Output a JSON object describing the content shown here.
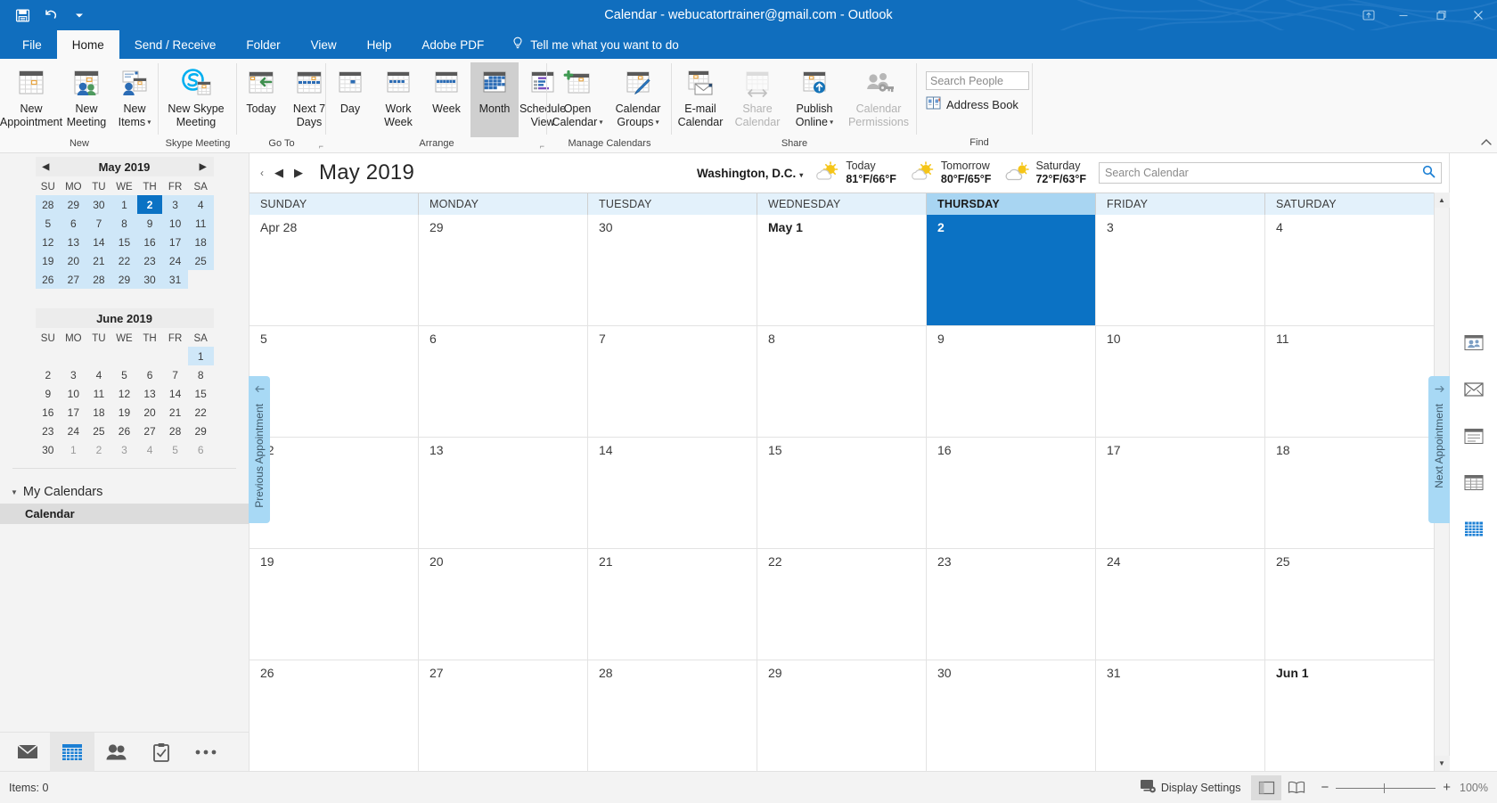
{
  "titlebar": {
    "title": "Calendar - webucatortrainer@gmail.com  -  Outlook",
    "qat": [
      {
        "name": "save-icon",
        "label": "Save"
      },
      {
        "name": "undo-icon",
        "label": "Undo"
      },
      {
        "name": "customize-qat-icon",
        "label": "Customize Quick Access Toolbar"
      }
    ],
    "window_buttons": [
      {
        "name": "ribbon-display-options-icon",
        "label": "Ribbon Display Options"
      },
      {
        "name": "minimize-icon",
        "label": "Minimize"
      },
      {
        "name": "restore-icon",
        "label": "Restore Down"
      },
      {
        "name": "close-icon",
        "label": "Close"
      }
    ]
  },
  "tabs": [
    {
      "id": "file",
      "label": "File",
      "active": false
    },
    {
      "id": "home",
      "label": "Home",
      "active": true
    },
    {
      "id": "send-receive",
      "label": "Send / Receive",
      "active": false
    },
    {
      "id": "folder",
      "label": "Folder",
      "active": false
    },
    {
      "id": "view",
      "label": "View",
      "active": false
    },
    {
      "id": "help",
      "label": "Help",
      "active": false
    },
    {
      "id": "adobe-pdf",
      "label": "Adobe PDF",
      "active": false
    }
  ],
  "tellme": "Tell me what you want to do",
  "ribbon": {
    "groups": [
      {
        "id": "new",
        "label": "New",
        "buttons": [
          {
            "id": "new-appointment",
            "label": "New\nAppointment",
            "icon": "calendar-new-icon"
          },
          {
            "id": "new-meeting",
            "label": "New\nMeeting",
            "icon": "calendar-people-icon"
          },
          {
            "id": "new-items",
            "label": "New\nItems",
            "icon": "new-items-icon",
            "dropdown": true
          }
        ]
      },
      {
        "id": "skype-meeting",
        "label": "Skype Meeting",
        "buttons": [
          {
            "id": "new-skype-meeting",
            "label": "New Skype\nMeeting",
            "icon": "skype-icon"
          }
        ]
      },
      {
        "id": "go-to",
        "label": "Go To",
        "dialog_launcher": true,
        "buttons": [
          {
            "id": "today",
            "label": "Today",
            "icon": "today-icon"
          },
          {
            "id": "next-7-days",
            "label": "Next 7\nDays",
            "icon": "next-7-days-icon"
          }
        ]
      },
      {
        "id": "arrange",
        "label": "Arrange",
        "dialog_launcher": true,
        "buttons": [
          {
            "id": "day",
            "label": "Day",
            "icon": "day-view-icon"
          },
          {
            "id": "work-week",
            "label": "Work\nWeek",
            "icon": "work-week-icon"
          },
          {
            "id": "week",
            "label": "Week",
            "icon": "week-view-icon"
          },
          {
            "id": "month",
            "label": "Month",
            "icon": "month-view-icon",
            "selected": true
          },
          {
            "id": "schedule-view",
            "label": "Schedule\nView",
            "icon": "schedule-view-icon"
          }
        ]
      },
      {
        "id": "manage-calendars",
        "label": "Manage Calendars",
        "buttons": [
          {
            "id": "open-calendar",
            "label": "Open\nCalendar",
            "icon": "open-calendar-icon",
            "dropdown": true
          },
          {
            "id": "calendar-groups",
            "label": "Calendar\nGroups",
            "icon": "calendar-groups-icon",
            "dropdown": true
          }
        ]
      },
      {
        "id": "share",
        "label": "Share",
        "buttons": [
          {
            "id": "email-calendar",
            "label": "E-mail\nCalendar",
            "icon": "email-calendar-icon"
          },
          {
            "id": "share-calendar",
            "label": "Share\nCalendar",
            "icon": "share-calendar-icon",
            "disabled": true
          },
          {
            "id": "publish-online",
            "label": "Publish\nOnline",
            "icon": "publish-online-icon",
            "dropdown": true
          },
          {
            "id": "calendar-permissions",
            "label": "Calendar\nPermissions",
            "icon": "calendar-permissions-icon",
            "disabled": true
          }
        ]
      },
      {
        "id": "find",
        "label": "Find",
        "search_people_placeholder": "Search People",
        "address_book_label": "Address Book"
      }
    ],
    "collapse_label": "Collapse the Ribbon"
  },
  "datenav": {
    "months": [
      {
        "id": "may-2019",
        "title": "May 2019",
        "show_arrows": true,
        "prev_label": "Previous month",
        "next_label": "Next month",
        "dow": [
          "SU",
          "MO",
          "TU",
          "WE",
          "TH",
          "FR",
          "SA"
        ],
        "weeks": [
          [
            {
              "d": "28",
              "hl": true
            },
            {
              "d": "29",
              "hl": true
            },
            {
              "d": "30",
              "hl": true
            },
            {
              "d": "1",
              "hl": true
            },
            {
              "d": "2",
              "today": true
            },
            {
              "d": "3",
              "hl": true
            },
            {
              "d": "4",
              "hl": true
            }
          ],
          [
            {
              "d": "5",
              "hl": true
            },
            {
              "d": "6",
              "hl": true
            },
            {
              "d": "7",
              "hl": true
            },
            {
              "d": "8",
              "hl": true
            },
            {
              "d": "9",
              "hl": true
            },
            {
              "d": "10",
              "hl": true
            },
            {
              "d": "11",
              "hl": true
            }
          ],
          [
            {
              "d": "12",
              "hl": true
            },
            {
              "d": "13",
              "hl": true
            },
            {
              "d": "14",
              "hl": true
            },
            {
              "d": "15",
              "hl": true
            },
            {
              "d": "16",
              "hl": true
            },
            {
              "d": "17",
              "hl": true
            },
            {
              "d": "18",
              "hl": true
            }
          ],
          [
            {
              "d": "19",
              "hl": true
            },
            {
              "d": "20",
              "hl": true
            },
            {
              "d": "21",
              "hl": true
            },
            {
              "d": "22",
              "hl": true
            },
            {
              "d": "23",
              "hl": true
            },
            {
              "d": "24",
              "hl": true
            },
            {
              "d": "25",
              "hl": true
            }
          ],
          [
            {
              "d": "26",
              "hl": true
            },
            {
              "d": "27",
              "hl": true
            },
            {
              "d": "28",
              "hl": true
            },
            {
              "d": "29",
              "hl": true
            },
            {
              "d": "30",
              "hl": true
            },
            {
              "d": "31",
              "hl": true
            },
            {
              "d": "",
              "hl": false
            }
          ]
        ]
      },
      {
        "id": "june-2019",
        "title": "June 2019",
        "show_arrows": false,
        "dow": [
          "SU",
          "MO",
          "TU",
          "WE",
          "TH",
          "FR",
          "SA"
        ],
        "weeks": [
          [
            {
              "d": ""
            },
            {
              "d": ""
            },
            {
              "d": ""
            },
            {
              "d": ""
            },
            {
              "d": ""
            },
            {
              "d": ""
            },
            {
              "d": "1",
              "hl": true
            }
          ],
          [
            {
              "d": "2"
            },
            {
              "d": "3"
            },
            {
              "d": "4"
            },
            {
              "d": "5"
            },
            {
              "d": "6"
            },
            {
              "d": "7"
            },
            {
              "d": "8"
            }
          ],
          [
            {
              "d": "9"
            },
            {
              "d": "10"
            },
            {
              "d": "11"
            },
            {
              "d": "12"
            },
            {
              "d": "13"
            },
            {
              "d": "14"
            },
            {
              "d": "15"
            }
          ],
          [
            {
              "d": "16"
            },
            {
              "d": "17"
            },
            {
              "d": "18"
            },
            {
              "d": "19"
            },
            {
              "d": "20"
            },
            {
              "d": "21"
            },
            {
              "d": "22"
            }
          ],
          [
            {
              "d": "23"
            },
            {
              "d": "24"
            },
            {
              "d": "25"
            },
            {
              "d": "26"
            },
            {
              "d": "27"
            },
            {
              "d": "28"
            },
            {
              "d": "29"
            }
          ],
          [
            {
              "d": "30"
            },
            {
              "d": "1",
              "dim": true
            },
            {
              "d": "2",
              "dim": true
            },
            {
              "d": "3",
              "dim": true
            },
            {
              "d": "4",
              "dim": true
            },
            {
              "d": "5",
              "dim": true
            },
            {
              "d": "6",
              "dim": true
            }
          ]
        ]
      }
    ]
  },
  "folderpane": {
    "group_label": "My Calendars",
    "items": [
      {
        "id": "calendar",
        "label": "Calendar",
        "selected": true
      }
    ]
  },
  "navbar": {
    "items": [
      {
        "id": "mail",
        "icon": "mail-icon",
        "label": "Mail",
        "active": false
      },
      {
        "id": "calendar",
        "icon": "calendar-icon",
        "label": "Calendar",
        "active": true
      },
      {
        "id": "people",
        "icon": "people-icon",
        "label": "People",
        "active": false
      },
      {
        "id": "tasks",
        "icon": "tasks-icon",
        "label": "Tasks",
        "active": false
      },
      {
        "id": "more",
        "icon": "more-options-icon",
        "label": "More",
        "active": false
      }
    ]
  },
  "calendar": {
    "collapse_pane_label": "Minimize the Folder Pane",
    "prev_label": "Back",
    "next_label": "Forward",
    "month_title": "May 2019",
    "location": "Washington,  D.C.",
    "weather": [
      {
        "id": "today",
        "icon": "partly-sunny-icon",
        "day": "Today",
        "temps": "81°F/66°F"
      },
      {
        "id": "tomorrow",
        "icon": "partly-sunny-icon",
        "day": "Tomorrow",
        "temps": "80°F/65°F"
      },
      {
        "id": "saturday",
        "icon": "partly-cloudy-icon",
        "day": "Saturday",
        "temps": "72°F/63°F"
      }
    ],
    "search_placeholder": "Search Calendar",
    "dow_headers": [
      {
        "label": "SUNDAY",
        "selected": false
      },
      {
        "label": "MONDAY",
        "selected": false
      },
      {
        "label": "TUESDAY",
        "selected": false
      },
      {
        "label": "WEDNESDAY",
        "selected": false
      },
      {
        "label": "THURSDAY",
        "selected": true
      },
      {
        "label": "FRIDAY",
        "selected": false
      },
      {
        "label": "SATURDAY",
        "selected": false
      }
    ],
    "weeks": [
      [
        {
          "label": "Apr 28"
        },
        {
          "label": "29"
        },
        {
          "label": "30"
        },
        {
          "label": "May 1",
          "bold": true
        },
        {
          "label": "2",
          "selected": true
        },
        {
          "label": "3"
        },
        {
          "label": "4"
        }
      ],
      [
        {
          "label": "5"
        },
        {
          "label": "6"
        },
        {
          "label": "7"
        },
        {
          "label": "8"
        },
        {
          "label": "9"
        },
        {
          "label": "10"
        },
        {
          "label": "11"
        }
      ],
      [
        {
          "label": "12"
        },
        {
          "label": "13"
        },
        {
          "label": "14"
        },
        {
          "label": "15"
        },
        {
          "label": "16"
        },
        {
          "label": "17"
        },
        {
          "label": "18"
        }
      ],
      [
        {
          "label": "19"
        },
        {
          "label": "20"
        },
        {
          "label": "21"
        },
        {
          "label": "22"
        },
        {
          "label": "23"
        },
        {
          "label": "24"
        },
        {
          "label": "25"
        }
      ],
      [
        {
          "label": "26"
        },
        {
          "label": "27"
        },
        {
          "label": "28"
        },
        {
          "label": "29"
        },
        {
          "label": "30"
        },
        {
          "label": "31"
        },
        {
          "label": "Jun 1",
          "bold": true
        }
      ]
    ],
    "prev_appointment_label": "Previous Appointment",
    "next_appointment_label": "Next Appointment"
  },
  "rightrail": {
    "items": [
      {
        "id": "people-peek",
        "icon": "people-peek-icon",
        "label": "People"
      },
      {
        "id": "mail-peek",
        "icon": "mail-peek-icon",
        "label": "Mail"
      },
      {
        "id": "notes-peek",
        "icon": "notes-peek-icon",
        "label": "Notes"
      },
      {
        "id": "tasks-peek",
        "icon": "tasks-peek-icon",
        "label": "Tasks"
      },
      {
        "id": "calendar-peek",
        "icon": "calendar-peek-icon",
        "label": "Calendar"
      }
    ]
  },
  "statusbar": {
    "items_count": "Items: 0",
    "display_settings": "Display Settings",
    "views": [
      {
        "id": "normal",
        "icon": "normal-view-icon",
        "active": true
      },
      {
        "id": "reading",
        "icon": "reading-view-icon",
        "active": false
      }
    ],
    "zoom_out": "−",
    "zoom_in": "+",
    "zoom_level": "100%"
  },
  "colors": {
    "accent": "#106ebe",
    "selected_day": "#0b72c4",
    "dow_header": "#e3f1fb",
    "dow_header_selected": "#a8d5f2",
    "peek_tab": "#a8d9f5",
    "mini_highlight": "#cfe7f8"
  }
}
